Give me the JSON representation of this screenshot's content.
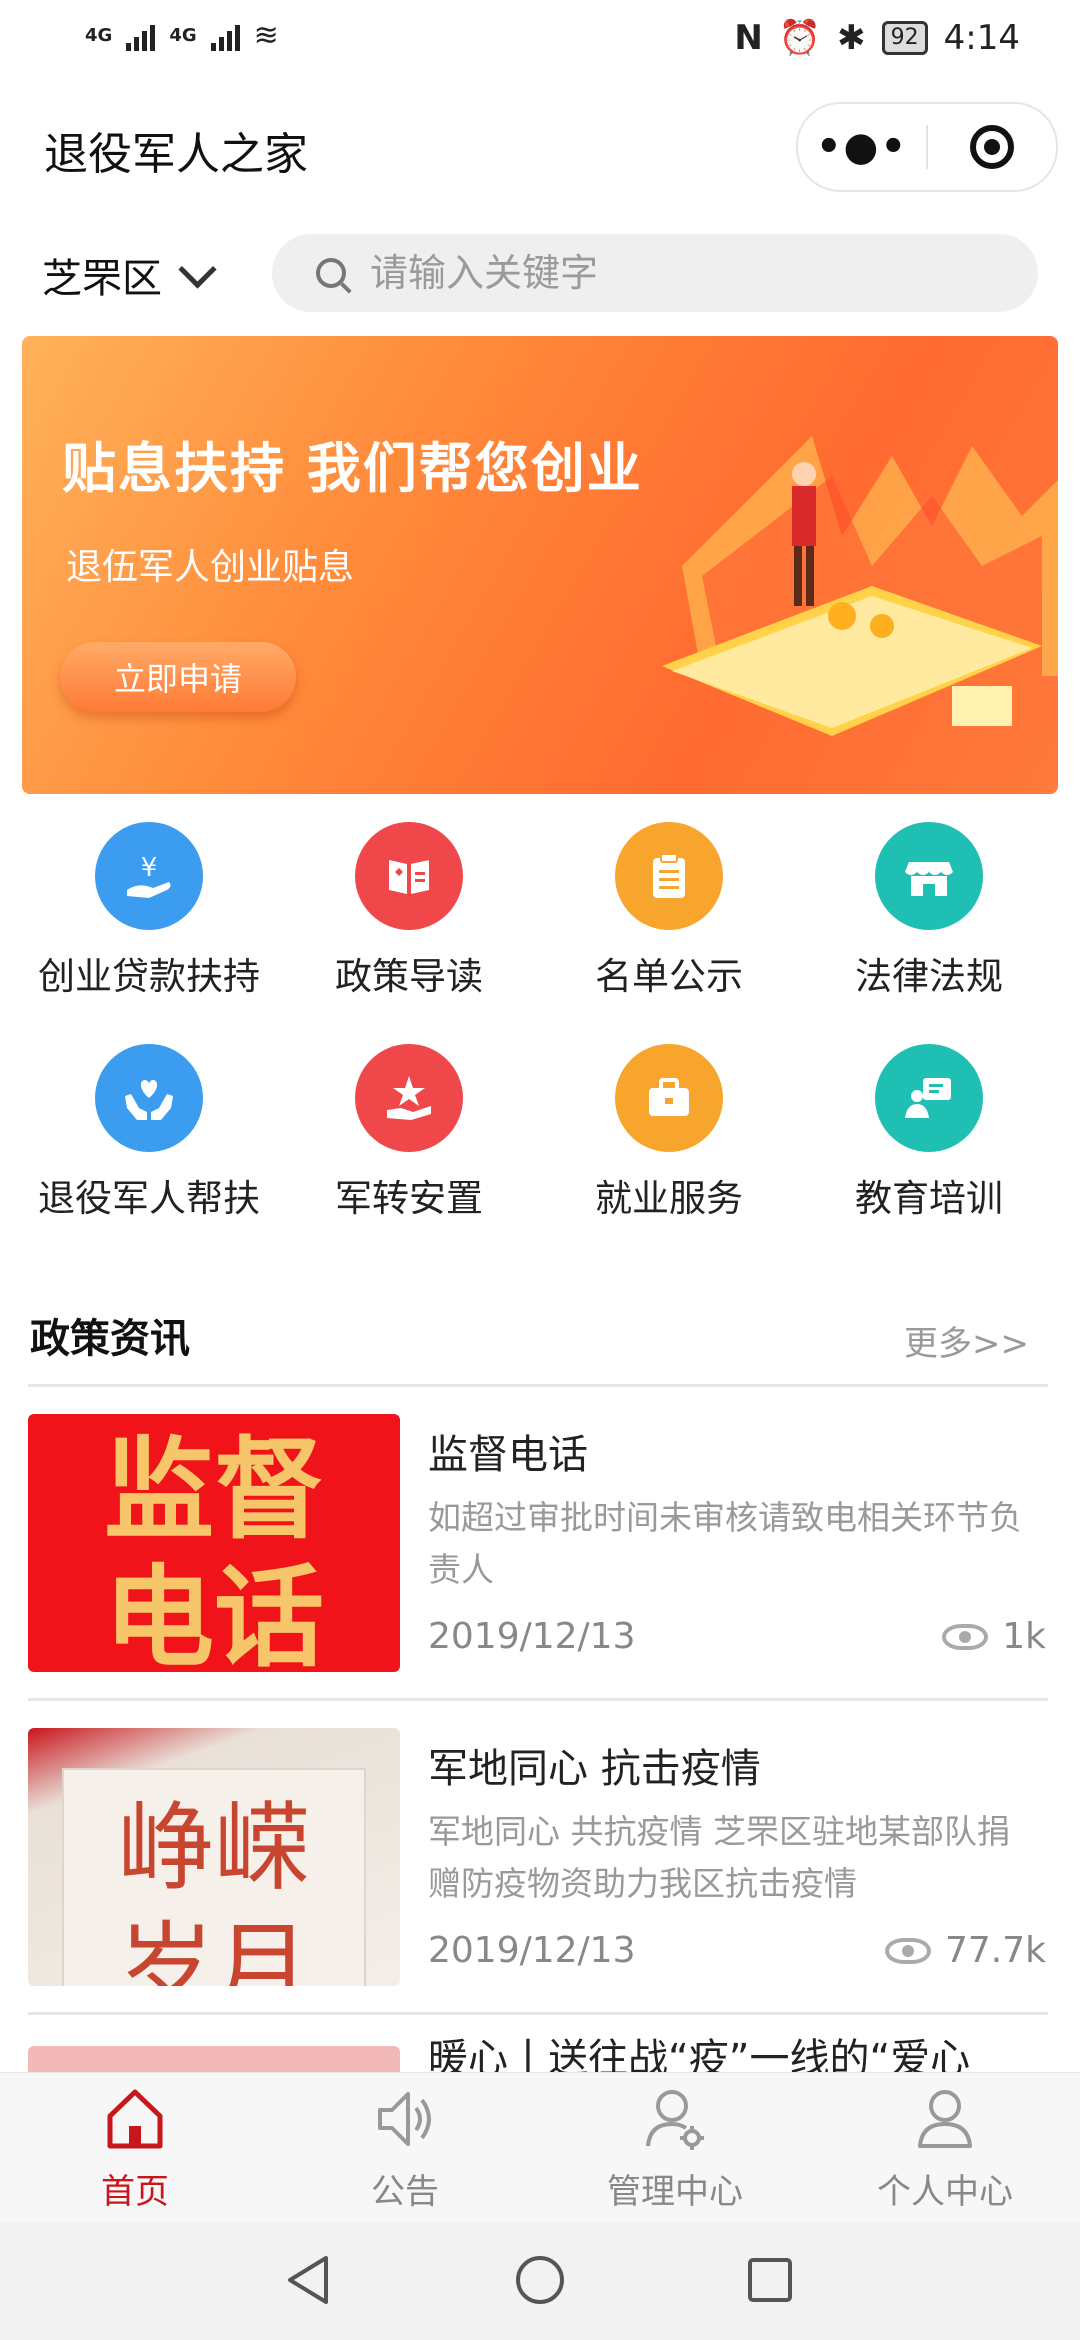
{
  "status_bar": {
    "network1": "4G",
    "network2": "4G",
    "battery": "92",
    "time": "4:14"
  },
  "header": {
    "title": "退役军人之家"
  },
  "search": {
    "region": "芝罘区",
    "placeholder": "请输入关键字"
  },
  "banner": {
    "headline": "贴息扶持 我们帮您创业",
    "subtitle": "退伍军人创业贴息",
    "button": "立即申请"
  },
  "grid": [
    {
      "label": "创业贷款扶持",
      "color": "#3b9cf0",
      "icon": "loan-hand-icon"
    },
    {
      "label": "政策导读",
      "color": "#f0484a",
      "icon": "policy-book-icon"
    },
    {
      "label": "名单公示",
      "color": "#f7a52d",
      "icon": "clipboard-list-icon"
    },
    {
      "label": "法律法规",
      "color": "#1fbfb4",
      "icon": "store-law-icon"
    },
    {
      "label": "退役军人帮扶",
      "color": "#3b9cf0",
      "icon": "heart-hands-icon"
    },
    {
      "label": "军转安置",
      "color": "#f0484a",
      "icon": "star-hand-icon"
    },
    {
      "label": "就业服务",
      "color": "#f7a52d",
      "icon": "briefcase-icon"
    },
    {
      "label": "教育培训",
      "color": "#1fbfb4",
      "icon": "training-person-icon"
    }
  ],
  "news": {
    "title": "政策资讯",
    "more": "更多>>",
    "items": [
      {
        "title": "监督电话",
        "desc": "如超过审批时间未审核请致电相关环节负责人",
        "date": "2019/12/13",
        "views": "1k",
        "thumb_text1": "监督",
        "thumb_text2": "电话"
      },
      {
        "title": "军地同心 抗击疫情",
        "desc": "军地同心 共抗疫情 芝罘区驻地某部队捐赠防疫物资助力我区抗击疫情",
        "date": "2019/12/13",
        "views": "77.7k",
        "thumb_text1": "峥嵘",
        "thumb_text2": "岁月"
      },
      {
        "title": "暖心丨送往战“疫”一线的“爱心"
      }
    ]
  },
  "tabs": [
    {
      "label": "首页",
      "icon": "home-icon",
      "active": true
    },
    {
      "label": "公告",
      "icon": "speaker-icon",
      "active": false
    },
    {
      "label": "管理中心",
      "icon": "user-gear-icon",
      "active": false
    },
    {
      "label": "个人中心",
      "icon": "user-icon",
      "active": false
    }
  ],
  "colors": {
    "accent": "#c8161d",
    "tab_inactive": "#888888"
  }
}
